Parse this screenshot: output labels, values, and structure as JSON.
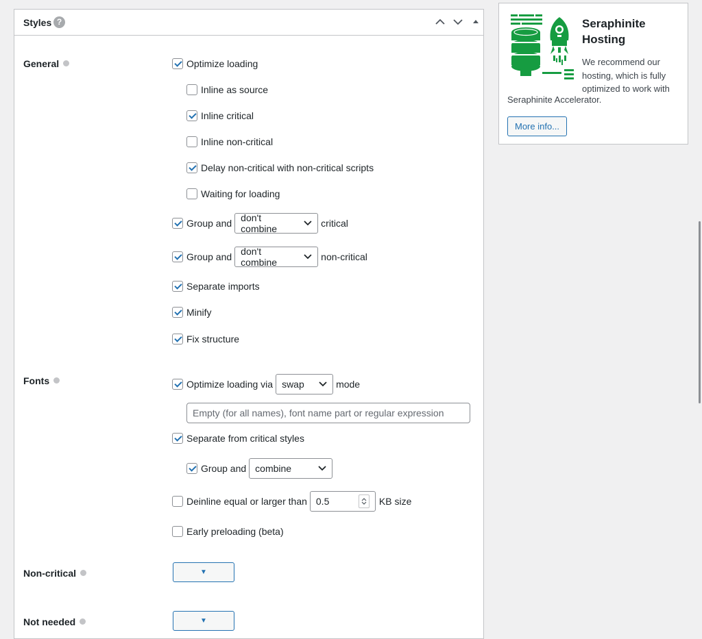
{
  "panel": {
    "title": "Styles",
    "help": "?"
  },
  "sections": {
    "general": "General",
    "fonts": "Fonts",
    "non_critical": "Non-critical",
    "not_needed": "Not needed"
  },
  "general": {
    "optimize_loading": {
      "label": "Optimize loading",
      "checked": true
    },
    "inline_as_source": {
      "label": "Inline as source",
      "checked": false
    },
    "inline_critical": {
      "label": "Inline critical",
      "checked": true
    },
    "inline_non_critical": {
      "label": "Inline non-critical",
      "checked": false
    },
    "delay_non_critical": {
      "label": "Delay non-critical with non-critical scripts",
      "checked": true
    },
    "waiting_for_loading": {
      "label": "Waiting for loading",
      "checked": false
    },
    "group_critical": {
      "prefix": "Group and",
      "select": "don't combine",
      "suffix": "critical",
      "checked": true
    },
    "group_non_critical": {
      "prefix": "Group and",
      "select": "don't combine",
      "suffix": "non-critical",
      "checked": true
    },
    "separate_imports": {
      "label": "Separate imports",
      "checked": true
    },
    "minify": {
      "label": "Minify",
      "checked": true
    },
    "fix_structure": {
      "label": "Fix structure",
      "checked": true
    }
  },
  "fonts": {
    "optimize_loading_via": {
      "prefix": "Optimize loading via",
      "select": "swap",
      "suffix": "mode",
      "checked": true
    },
    "font_filter": {
      "value": "",
      "placeholder": "Empty (for all names), font name part or regular expression"
    },
    "separate_from_critical": {
      "label": "Separate from critical styles",
      "checked": true
    },
    "group_and": {
      "prefix": "Group and",
      "select": "combine",
      "checked": true
    },
    "deinline": {
      "prefix": "Deinline equal or larger than",
      "value": "0.5",
      "suffix": "KB size",
      "checked": false
    },
    "early_preloading": {
      "label": "Early preloading (beta)",
      "checked": false
    }
  },
  "dropdown_arrow": "▼",
  "sidebar": {
    "title": "Seraphinite Hosting",
    "text_a": "We recommend our hosting, which is fully optimized to work with",
    "text_b": "Seraphinite Accelerator.",
    "button": "More info..."
  },
  "colors": {
    "brand_green": "#169c41",
    "accent_blue": "#2271b1"
  }
}
